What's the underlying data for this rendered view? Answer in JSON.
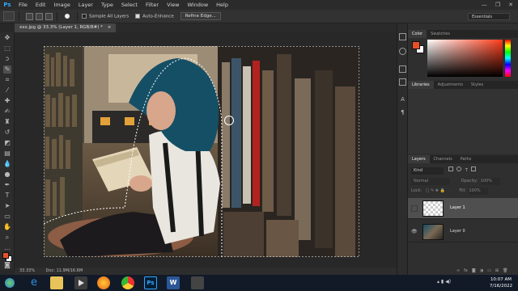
{
  "app": {
    "logo": "Ps"
  },
  "menu": [
    "File",
    "Edit",
    "Image",
    "Layer",
    "Type",
    "Select",
    "Filter",
    "View",
    "Window",
    "Help"
  ],
  "window_controls": [
    "—",
    "❐",
    "✕"
  ],
  "options_bar": {
    "sample_all_layers": "Sample All Layers",
    "auto_enhance": "Auto-Enhance",
    "refine_edge": "Refine Edge...",
    "workspace": "Essentials"
  },
  "document": {
    "tab_title": "xxx.jpg @ 33.3% (Layer 1, RGB/8#) *",
    "close": "×"
  },
  "status": {
    "zoom": "33.33%",
    "doc": "Doc: 11.9M/16.6M"
  },
  "color_panel": {
    "tabs": [
      "Color",
      "Swatches"
    ],
    "fg": "#e8502a",
    "bg": "#ffffff"
  },
  "libraries_panel": {
    "tabs": [
      "Libraries",
      "Adjustments",
      "Styles"
    ]
  },
  "layers_panel": {
    "tabs": [
      "Layers",
      "Channels",
      "Paths"
    ],
    "filter": "Kind",
    "blend_mode": "Normal",
    "opacity_label": "Opacity:",
    "opacity_value": "100%",
    "lock_label": "Lock:",
    "fill_label": "Fill:",
    "fill_value": "100%",
    "layers": [
      {
        "name": "Layer 1",
        "visible": false,
        "selected": true
      },
      {
        "name": "Layer 0",
        "visible": true,
        "selected": false
      }
    ]
  },
  "taskbar": {
    "time": "10:07 AM",
    "date": "7/16/2022"
  }
}
